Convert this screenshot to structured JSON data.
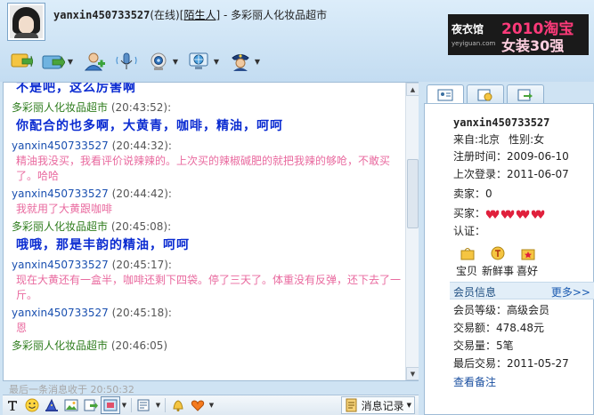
{
  "header": {
    "nickname": "yanxin450733527",
    "status": "(在线)",
    "stranger_label": "陌生人",
    "shop_name": " - 多彩丽人化妆品超市"
  },
  "ad": {
    "logo_text": "夜衣馆",
    "logo_sub": "yeyiguan.com",
    "year_text": "2010淘宝",
    "line2": "女装30强"
  },
  "chat": {
    "messages": [
      {
        "body": "不是吧，这么厉害啊",
        "style": "big"
      },
      {
        "sender": "多彩丽人化妆品超市",
        "time": "(20:43:52):",
        "body": "你配合的也多啊，大黄青，咖啡，精油，呵呵",
        "style": "big",
        "who": "me"
      },
      {
        "sender": "yanxin450733527",
        "time": "(20:44:32):",
        "body": "精油我没买，我看评价说辣辣的。上次买的辣椒碱肥的就把我辣的够呛，不敢买了。哈哈",
        "style": "pink",
        "who": "other"
      },
      {
        "sender": "yanxin450733527",
        "time": "(20:44:42):",
        "body": "我就用了大黄跟咖啡",
        "style": "pink",
        "who": "other"
      },
      {
        "sender": "多彩丽人化妆品超市",
        "time": "(20:45:08):",
        "body": "哦哦，那是丰韵的精油，呵呵",
        "style": "big",
        "who": "me"
      },
      {
        "sender": "yanxin450733527",
        "time": "(20:45:17):",
        "body": "现在大黄还有一盒半，咖啡还剩下四袋。停了三天了。体重没有反弹，还下去了一斤。",
        "style": "pink",
        "who": "other"
      },
      {
        "sender": "yanxin450733527",
        "time": "(20:45:18):",
        "body": "恩",
        "style": "pink",
        "who": "other"
      },
      {
        "sender": "多彩丽人化妆品超市",
        "time": "(20:46:05)",
        "body": "",
        "style": "big",
        "who": "me"
      }
    ],
    "last_msg_status": "最后一条消息收于 20:50:32"
  },
  "bottom": {
    "history_label": "消息记录"
  },
  "profile": {
    "tab_icons": [
      "profile-card-icon",
      "clock-icon",
      "trade-icon"
    ],
    "nickname": "yanxin450733527",
    "from_label": "来自:",
    "from_value": "北京",
    "gender_label": "性别:",
    "gender_value": "女",
    "registered": "注册时间：2009-06-10",
    "last_login": "上次登录：2011-06-07",
    "seller": "卖家：0",
    "buyer_label": "买家：",
    "buyer_hearts": 4,
    "verify": "认证：",
    "icons": [
      {
        "label": "宝贝",
        "icon": "shop-bag-icon"
      },
      {
        "label": "新鲜事",
        "icon": "news-icon"
      },
      {
        "label": "喜好",
        "icon": "favorite-box-icon"
      }
    ],
    "member_info_label": "会员信息",
    "more_label": "更多>>",
    "member_level": "会员等级：高级会员",
    "trade_amount": "交易额：478.48元",
    "trade_count": "交易量：5笔",
    "last_trade": "最后交易：2011-05-27",
    "backup_link": "查看备注"
  },
  "colors": {
    "me_name": "#2f7d1e",
    "other_name": "#1a50b0",
    "big_text": "#0a2bd1",
    "pink_text": "#e96a9f",
    "heart": "#e0203c"
  }
}
